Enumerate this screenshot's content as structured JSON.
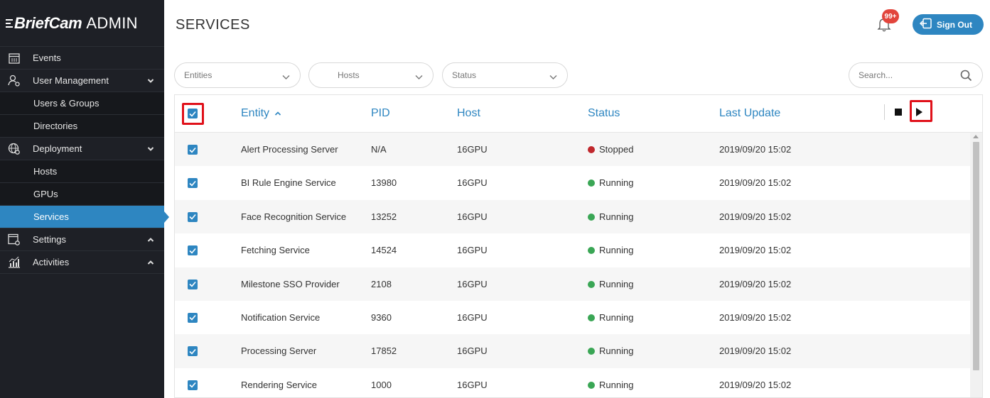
{
  "brand": {
    "name": "BriefCam",
    "admin": "ADMIN"
  },
  "sidebar": {
    "items": [
      {
        "label": "Events",
        "icon": "calendar-icon"
      },
      {
        "label": "User Management",
        "icon": "user-settings-icon",
        "chevron": "down"
      },
      {
        "label": "Users & Groups"
      },
      {
        "label": "Directories"
      },
      {
        "label": "Deployment",
        "icon": "globe-settings-icon",
        "chevron": "down"
      },
      {
        "label": "Hosts"
      },
      {
        "label": "GPUs"
      },
      {
        "label": "Services",
        "active": true
      },
      {
        "label": "Settings",
        "icon": "window-settings-icon",
        "chevron": "up"
      },
      {
        "label": "Activities",
        "icon": "chart-icon",
        "chevron": "up"
      }
    ]
  },
  "header": {
    "title": "SERVICES",
    "notification_badge": "99+",
    "signout_label": "Sign Out"
  },
  "filters": {
    "entities": "Entities",
    "hosts": "Hosts",
    "status": "Status",
    "search_placeholder": "Search..."
  },
  "table": {
    "columns": {
      "entity": "Entity",
      "pid": "PID",
      "host": "Host",
      "status": "Status",
      "last_update": "Last Update"
    },
    "sort_indicator": "^",
    "header_checked": true,
    "rows": [
      {
        "entity": "Alert Processing Server",
        "pid": "N/A",
        "host": "16GPU",
        "status": "Stopped",
        "last_update": "2019/09/20 15:02",
        "checked": true
      },
      {
        "entity": "BI Rule Engine Service",
        "pid": "13980",
        "host": "16GPU",
        "status": "Running",
        "last_update": "2019/09/20 15:02",
        "checked": true
      },
      {
        "entity": "Face Recognition Service",
        "pid": "13252",
        "host": "16GPU",
        "status": "Running",
        "last_update": "2019/09/20 15:02",
        "checked": true
      },
      {
        "entity": "Fetching Service",
        "pid": "14524",
        "host": "16GPU",
        "status": "Running",
        "last_update": "2019/09/20 15:02",
        "checked": true
      },
      {
        "entity": "Milestone SSO Provider",
        "pid": "2108",
        "host": "16GPU",
        "status": "Running",
        "last_update": "2019/09/20 15:02",
        "checked": true
      },
      {
        "entity": "Notification Service",
        "pid": "9360",
        "host": "16GPU",
        "status": "Running",
        "last_update": "2019/09/20 15:02",
        "checked": true
      },
      {
        "entity": "Processing Server",
        "pid": "17852",
        "host": "16GPU",
        "status": "Running",
        "last_update": "2019/09/20 15:02",
        "checked": true
      },
      {
        "entity": "Rendering Service",
        "pid": "1000",
        "host": "16GPU",
        "status": "Running",
        "last_update": "2019/09/20 15:02",
        "checked": true
      }
    ]
  },
  "colors": {
    "accent": "#2e86c1",
    "stopped": "#c0282d",
    "running": "#3aa655",
    "highlight": "#e0111a",
    "sidebar": "#1e2026"
  }
}
